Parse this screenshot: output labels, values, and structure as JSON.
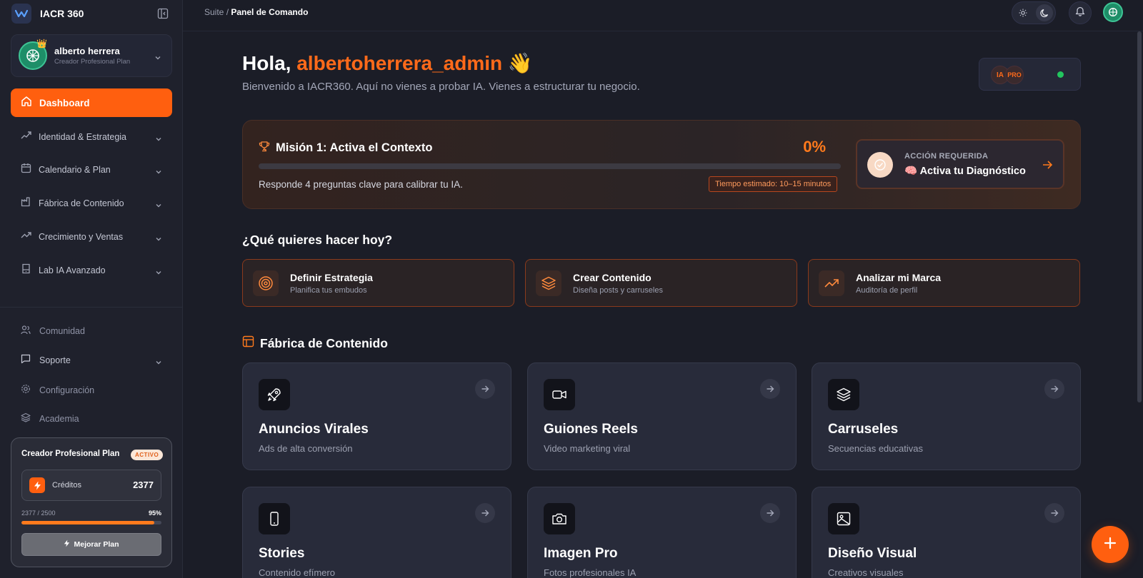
{
  "app": {
    "name": "IACR 360"
  },
  "profile": {
    "name": "alberto herrera",
    "plan": "Creador Profesional Plan"
  },
  "nav": {
    "dashboard": "Dashboard",
    "items": [
      {
        "label": "Identidad & Estrategia",
        "icon": "strategy-icon"
      },
      {
        "label": "Calendario & Plan",
        "icon": "calendar-icon"
      },
      {
        "label": "Fábrica de Contenido",
        "icon": "factory-icon"
      },
      {
        "label": "Crecimiento y Ventas",
        "icon": "trending-up-icon"
      },
      {
        "label": "Lab IA Avanzado",
        "icon": "flask-icon"
      }
    ],
    "secondary": [
      {
        "label": "Comunidad",
        "icon": "users-icon"
      },
      {
        "label": "Soporte",
        "icon": "chat-icon"
      },
      {
        "label": "Configuración",
        "icon": "gear-icon"
      },
      {
        "label": "Academia",
        "icon": "layers-icon"
      }
    ]
  },
  "plan_card": {
    "title": "Creador Profesional Plan",
    "badge": "ACTIVO",
    "credits_label": "Créditos",
    "credits_value": "2377",
    "usage_text": "2377 / 2500",
    "usage_percent_label": "95%",
    "usage_fraction": 0.95,
    "upgrade_label": "Mejorar Plan"
  },
  "topbar": {
    "crumb_root": "Suite",
    "crumb_sep": " / ",
    "crumb_current": "Panel de Comando"
  },
  "greeting": {
    "hello": "Hola, ",
    "username": "albertoherrera_admin",
    "emoji": "👋",
    "subtitle": "Bienvenido a IACR360. Aquí no vienes a probar IA. Vienes a estructurar tu negocio."
  },
  "ia_status": {
    "chip1": "IA",
    "chip2": "PRO",
    "status_color": "#22c55e"
  },
  "mission": {
    "title": "Misión 1: Activa el Contexto",
    "percent_label": "0%",
    "progress": 0,
    "description": "Responde 4 preguntas clave para calibrar tu IA.",
    "time_estimate": "Tiempo estimado: 10–15 minutos",
    "action_kicker": "ACCIÓN REQUERIDA",
    "action_emoji": "🧠",
    "action_title": "Activa tu Diagnóstico"
  },
  "today": {
    "heading": "¿Qué quieres hacer hoy?",
    "actions": [
      {
        "title": "Definir Estrategia",
        "subtitle": "Planifica tus embudos",
        "icon": "target-icon"
      },
      {
        "title": "Crear Contenido",
        "subtitle": "Diseña posts y carruseles",
        "icon": "layers-icon"
      },
      {
        "title": "Analizar mi Marca",
        "subtitle": "Auditoría de perfil",
        "icon": "trending-up-icon"
      }
    ]
  },
  "factory": {
    "heading": "Fábrica de Contenido",
    "tools": [
      {
        "title": "Anuncios Virales",
        "subtitle": "Ads de alta conversión",
        "icon": "rocket-icon"
      },
      {
        "title": "Guiones Reels",
        "subtitle": "Video marketing viral",
        "icon": "video-icon"
      },
      {
        "title": "Carruseles",
        "subtitle": "Secuencias educativas",
        "icon": "layers-icon"
      },
      {
        "title": "Stories",
        "subtitle": "Contenido efímero",
        "icon": "phone-icon"
      },
      {
        "title": "Imagen Pro",
        "subtitle": "Fotos profesionales IA",
        "icon": "camera-icon"
      },
      {
        "title": "Diseño Visual",
        "subtitle": "Creativos visuales",
        "icon": "image-icon"
      }
    ]
  },
  "colors": {
    "accent": "#ff5f0f",
    "background": "#1b1d27",
    "sidebar": "#1f212c",
    "card": "#282b3a"
  }
}
